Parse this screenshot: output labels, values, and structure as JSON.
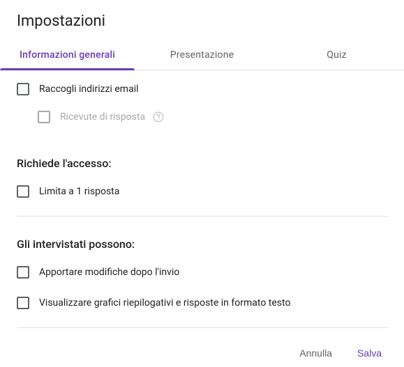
{
  "title": "Impostazioni",
  "tabs": {
    "general": "Informazioni generali",
    "presentation": "Presentazione",
    "quiz": "Quiz"
  },
  "options": {
    "collect_email": "Raccogli indirizzi email",
    "response_receipts": "Ricevute di risposta"
  },
  "sections": {
    "requires_signin": "Richiede l'accesso:",
    "limit_one": "Limita a 1 risposta",
    "respondents_can": "Gli intervistati possono:",
    "edit_after": "Apportare modifiche dopo l'invio",
    "see_summary": "Visualizzare grafici riepilogativi e risposte in formato testo"
  },
  "buttons": {
    "cancel": "Annulla",
    "save": "Salva"
  }
}
